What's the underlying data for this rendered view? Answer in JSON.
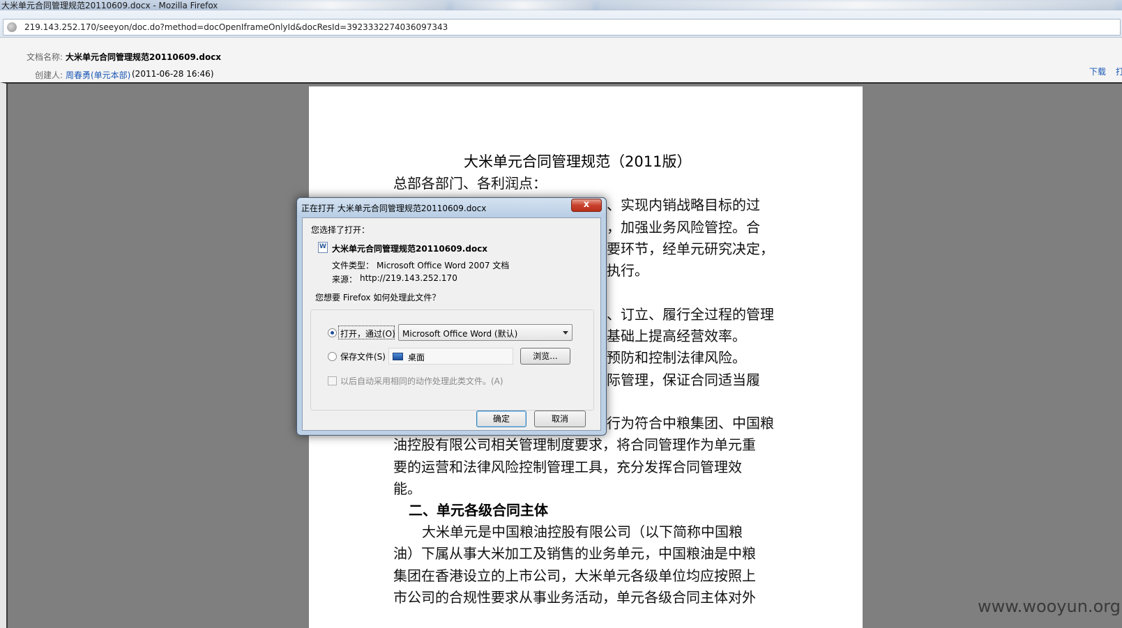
{
  "browser": {
    "window_title": "大米单元合同管理规范20110609.docx - Mozilla Firefox",
    "url": "219.143.252.170/seeyon/doc.do?method=docOpenIframeOnlyId&docResId=3923332274036097343"
  },
  "doc_header": {
    "name_label": "文档名称:",
    "name_value": "大米单元合同管理规范20110609.docx",
    "creator_label": "创建人:",
    "creator_value": "周春勇(单元本部)",
    "created_time": "(2011-06-28 16:46)",
    "download_label": "下载",
    "print_label": "打"
  },
  "document": {
    "title": "大米单元合同管理规范（2011版）",
    "lines": [
      "总部各部门、各利润点：",
      "、实现内销战略目标的过",
      "，加强业务风险管控。合",
      "要环节，经单元研究决定，",
      "执行。",
      "、订立、履行全过程的管理",
      "基础上提高经营效率。",
      "预防和控制法律风险。",
      "际管理，保证合同适当履",
      "行为符合中粮集团、中国粮",
      "油控股有限公司相关管理制度要求，将合同管理作为单元重",
      "要的运营和法律风险控制管理工具，充分发挥合同管理效",
      "能。",
      "大米单元是中国粮油控股有限公司（以下简称中国粮",
      "油）下属从事大米加工及销售的业务单元，中国粮油是中粮",
      "集团在香港设立的上市公司，大米单元各级单位均应按照上",
      "市公司的合规性要求从事业务活动，单元各级合同主体对外"
    ],
    "heading_2": "二、单元各级合同主体"
  },
  "dialog": {
    "title": "正在打开 大米单元合同管理规范20110609.docx",
    "close_label": "x",
    "chosen_label": "您选择了打开：",
    "file_name": "大米单元合同管理规范20110609.docx",
    "file_type_label": "文件类型：",
    "file_type_value": "Microsoft Office Word 2007 文档",
    "source_label": "来源：",
    "source_value": "http://219.143.252.170",
    "question": "您想要 Firefox 如何处理此文件？",
    "open_with_label": "打开，通过(O)",
    "open_with_app": "Microsoft Office Word (默认)",
    "save_label": "保存文件(S)",
    "save_folder": "桌面",
    "browse_button": "浏览...",
    "auto_label": "以后自动采用相同的动作处理此类文件。(A)",
    "ok_button": "确定",
    "cancel_button": "取消"
  },
  "watermark": "www.wooyun.org"
}
